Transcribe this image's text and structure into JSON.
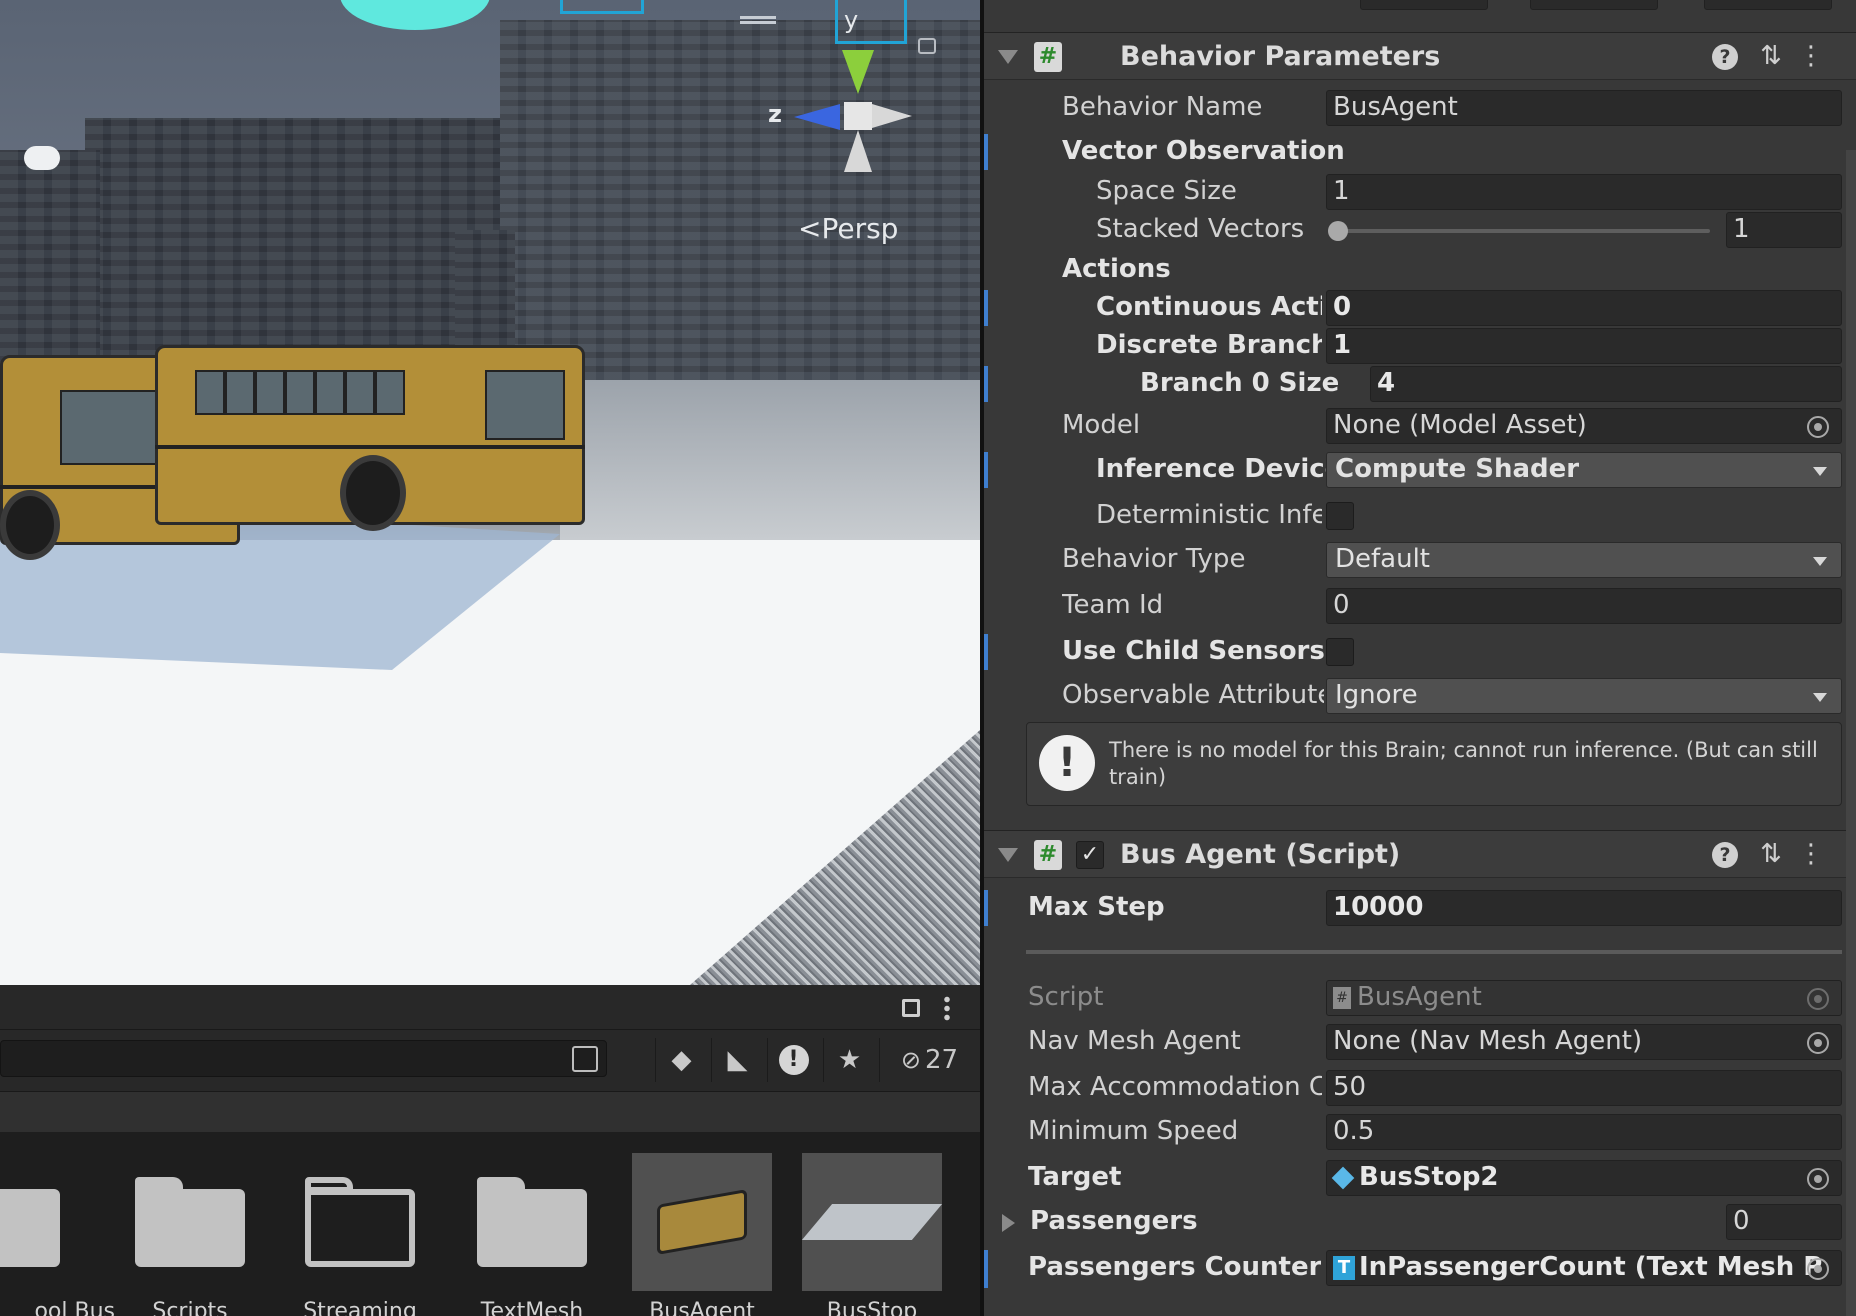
{
  "scene": {
    "persp_label": "Persp",
    "axis_y": "y",
    "axis_z": "z"
  },
  "project": {
    "hidden_count": "27",
    "assets": [
      {
        "label": "ool Bus"
      },
      {
        "label": "Scripts"
      },
      {
        "label": "Streaming"
      },
      {
        "label": "TextMesh"
      },
      {
        "label": "BusAgent"
      },
      {
        "label": "BusStop"
      }
    ]
  },
  "behavior_parameters": {
    "title": "Behavior Parameters",
    "behavior_name": {
      "label": "Behavior Name",
      "value": "BusAgent"
    },
    "vector_observation": "Vector Observation",
    "space_size": {
      "label": "Space Size",
      "value": "1"
    },
    "stacked_vectors": {
      "label": "Stacked Vectors",
      "value": "1"
    },
    "actions": "Actions",
    "continuous_actions": {
      "label": "Continuous Actio",
      "value": "0"
    },
    "discrete_branches": {
      "label": "Discrete Branche",
      "value": "1"
    },
    "branch_0_size": {
      "label": "Branch 0 Size",
      "value": "4"
    },
    "model": {
      "label": "Model",
      "value": "None (Model Asset)"
    },
    "inference_device": {
      "label": "Inference Device",
      "value": "Compute Shader"
    },
    "deterministic_inference": {
      "label": "Deterministic Infer"
    },
    "behavior_type": {
      "label": "Behavior Type",
      "value": "Default"
    },
    "team_id": {
      "label": "Team Id",
      "value": "0"
    },
    "use_child_sensors": {
      "label": "Use Child Sensors"
    },
    "observable_attribute": {
      "label": "Observable Attribute",
      "value": "Ignore"
    },
    "warning": "There is no model for this Brain; cannot run inference. (But can still train)"
  },
  "bus_agent": {
    "title": "Bus Agent (Script)",
    "max_step": {
      "label": "Max Step",
      "value": "10000"
    },
    "script": {
      "label": "Script",
      "value": "BusAgent"
    },
    "nav_mesh_agent": {
      "label": "Nav Mesh Agent",
      "value": "None (Nav Mesh Agent)"
    },
    "max_accommodation": {
      "label": "Max Accommodation C",
      "value": "50"
    },
    "minimum_speed": {
      "label": "Minimum Speed",
      "value": "0.5"
    },
    "target": {
      "label": "Target",
      "value": "BusStop2"
    },
    "passengers": {
      "label": "Passengers",
      "value": "0"
    },
    "passengers_counter": {
      "label": "Passengers Counter",
      "value": "InPassengerCount (Text Mesh P"
    }
  },
  "colors": {
    "accent_blue": "#3f7fd0",
    "inspector_bg": "#383838",
    "bus_yellow": "#b38f38"
  }
}
